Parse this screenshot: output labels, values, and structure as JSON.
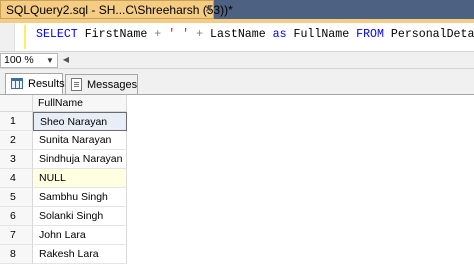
{
  "document_tab": {
    "title": "SQLQuery2.sql - SH...C\\Shreeharsh (53))*",
    "close_glyph": "×"
  },
  "editor": {
    "sql_tokens": [
      {
        "text": "SELECT",
        "kind": "kw"
      },
      {
        "text": " FirstName ",
        "kind": "plain"
      },
      {
        "text": "+",
        "kind": "op"
      },
      {
        "text": " ",
        "kind": "plain"
      },
      {
        "text": "' '",
        "kind": "str"
      },
      {
        "text": " ",
        "kind": "plain"
      },
      {
        "text": "+",
        "kind": "op"
      },
      {
        "text": " LastName ",
        "kind": "plain"
      },
      {
        "text": "as",
        "kind": "kw"
      },
      {
        "text": " FullName ",
        "kind": "plain"
      },
      {
        "text": "FROM",
        "kind": "kw"
      },
      {
        "text": " PersonalDetails",
        "kind": "plain"
      }
    ]
  },
  "zoom": {
    "value": "100 %"
  },
  "result_tabs": [
    {
      "label": "Results",
      "icon": "grid-icon",
      "active": true
    },
    {
      "label": "Messages",
      "icon": "messages-icon",
      "active": false
    }
  ],
  "grid": {
    "column_header": "FullName",
    "rows": [
      {
        "num": "1",
        "value": "Sheo Narayan",
        "selected": true
      },
      {
        "num": "2",
        "value": "Sunita Narayan"
      },
      {
        "num": "3",
        "value": "Sindhuja Narayan"
      },
      {
        "num": "4",
        "value": "NULL",
        "null": true
      },
      {
        "num": "5",
        "value": "Sambhu Singh"
      },
      {
        "num": "6",
        "value": "Solanki Singh"
      },
      {
        "num": "7",
        "value": "John Lara"
      },
      {
        "num": "8",
        "value": "Rakesh Lara"
      }
    ]
  },
  "colors": {
    "tab_active": "#f5cc84",
    "tab_strip_bg": "#4d6182",
    "keyword": "#0000ff",
    "string": "#ff0000",
    "operator": "#808080",
    "null_cell": "#ffffe1"
  }
}
